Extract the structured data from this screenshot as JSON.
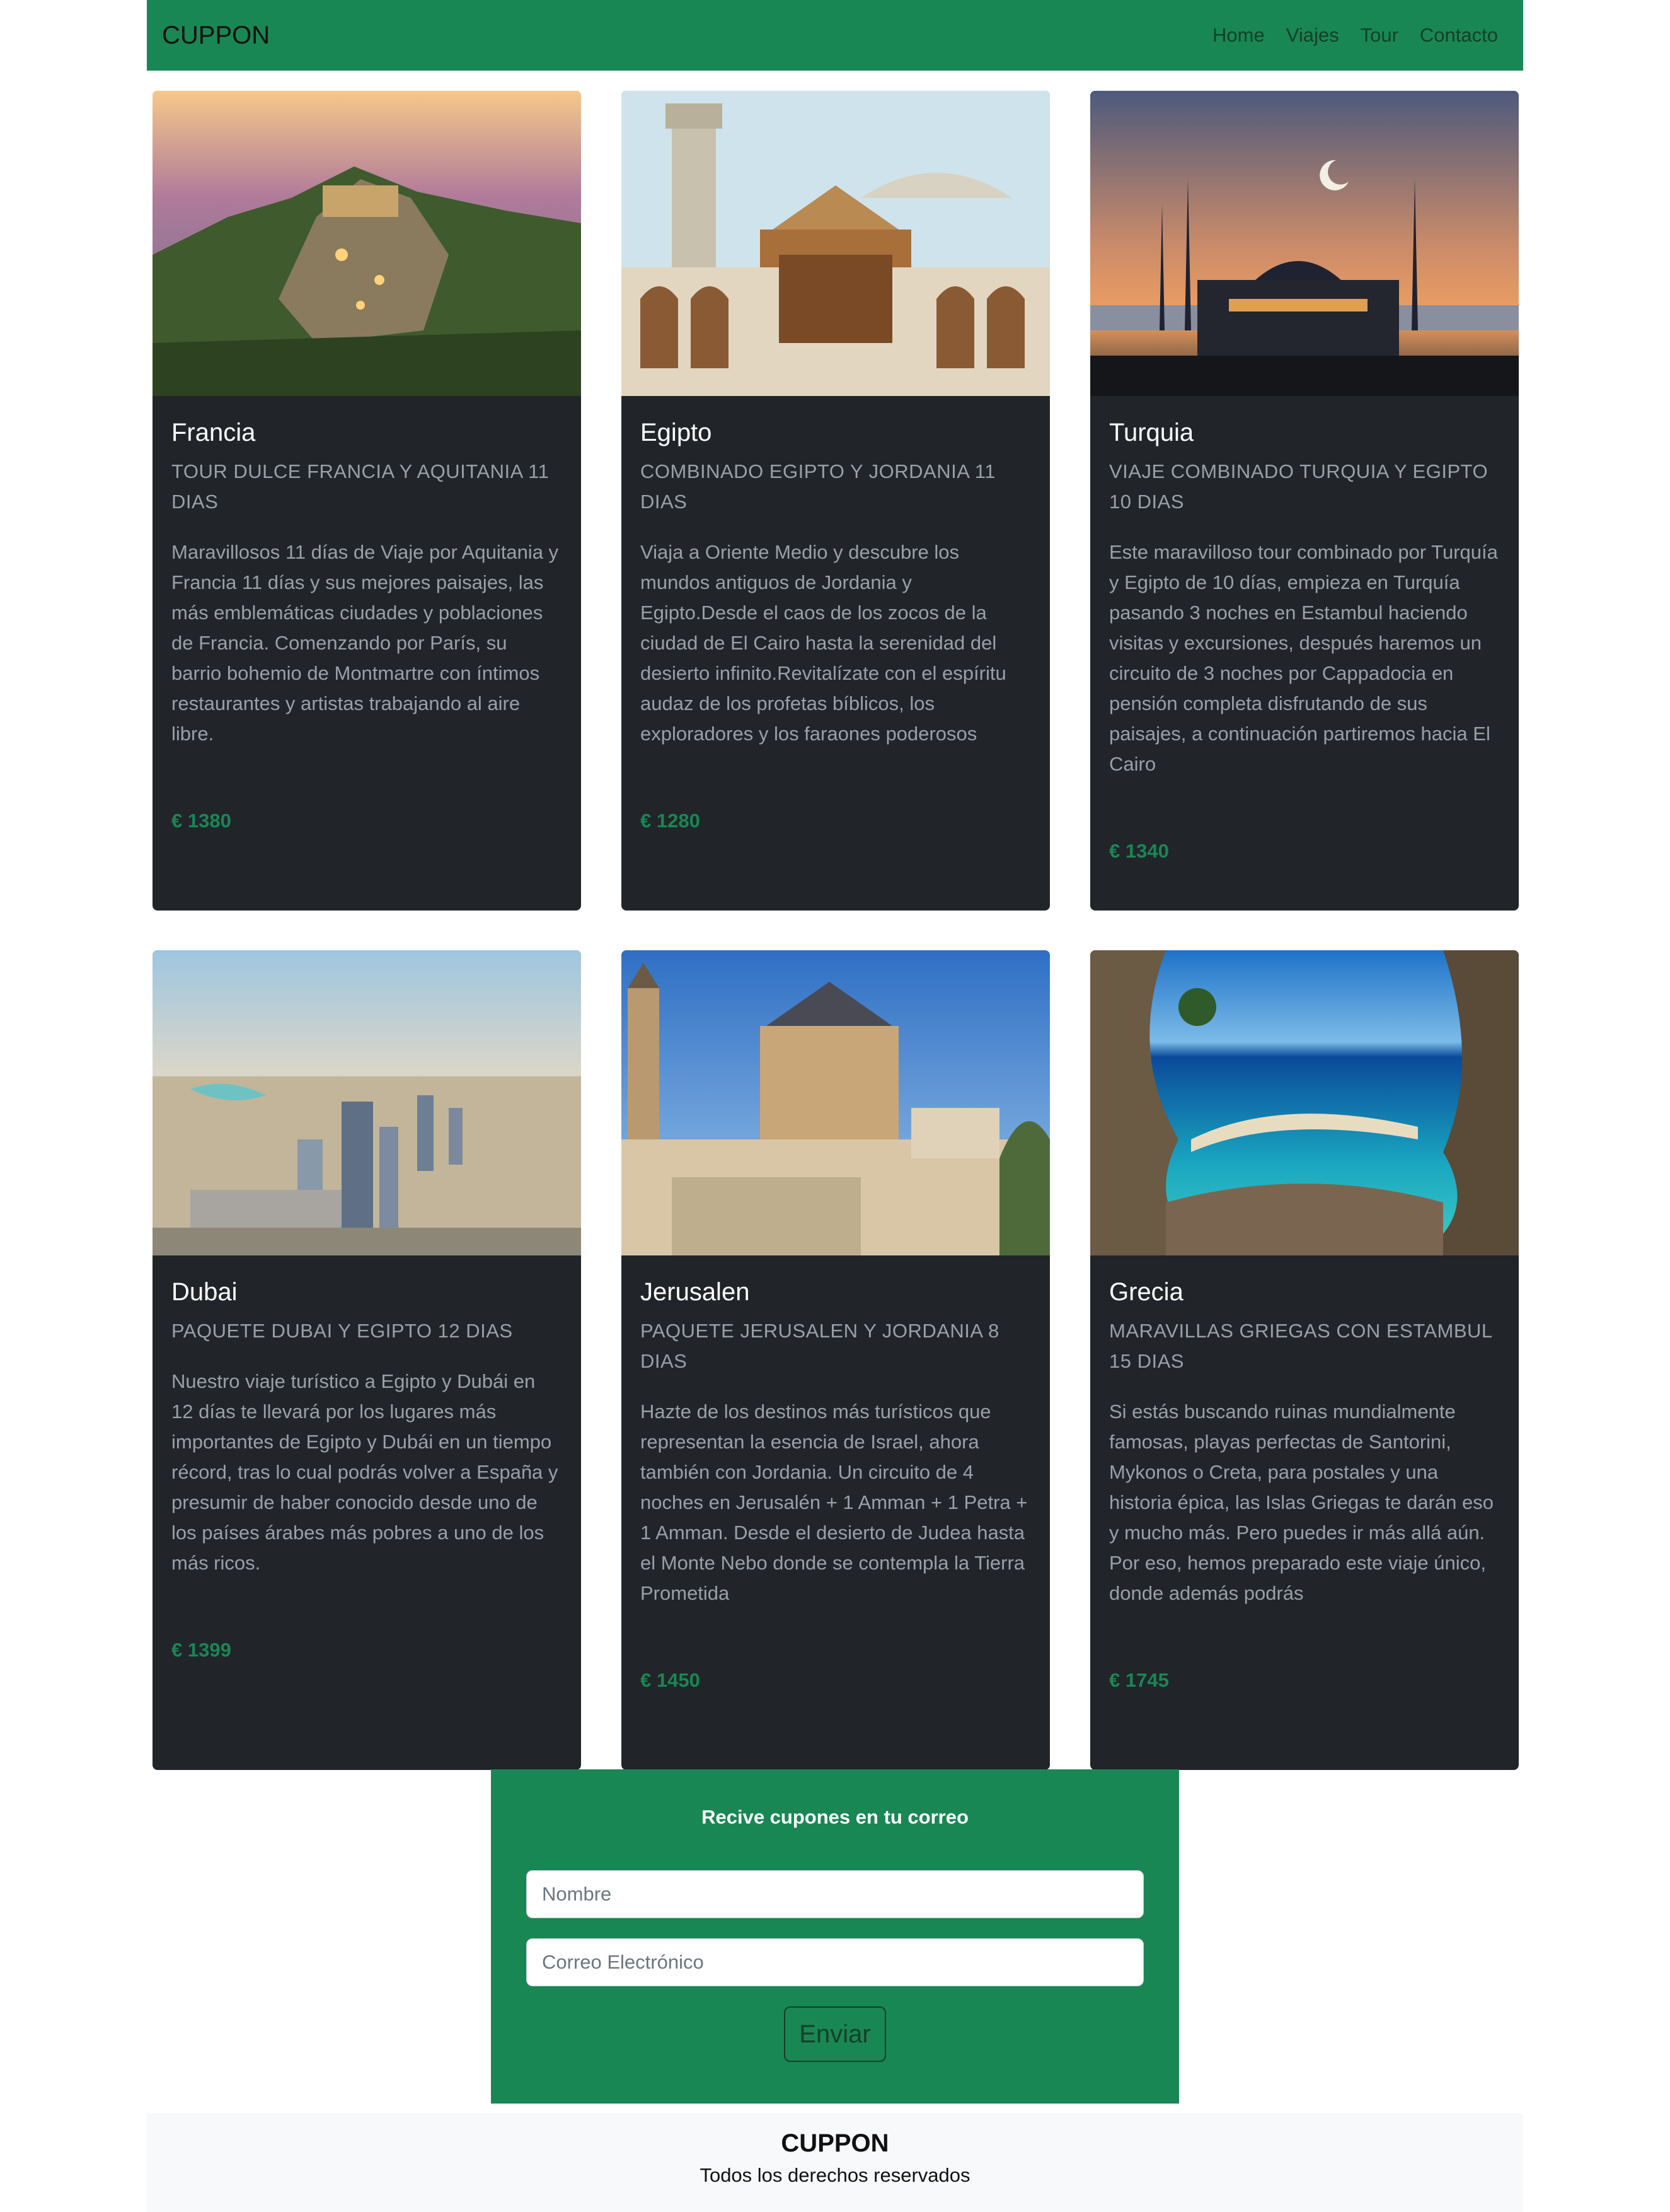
{
  "navbar": {
    "brand": "CUPPON",
    "links": [
      "Home",
      "Viajes",
      "Tour",
      "Contacto"
    ]
  },
  "cards": [
    {
      "title": "Francia",
      "subtitle": "TOUR DULCE FRANCIA Y AQUITANIA 11 DIAS",
      "text": "Maravillosos 11 días de Viaje por Aquitania y Francia 11 días y sus mejores paisajes, las más emblemáticas ciudades y poblaciones de Francia. Comenzando por París, su barrio bohemio de Montmartre con íntimos restaurantes y artistas trabajando al aire libre.",
      "price": "€ 1380"
    },
    {
      "title": "Egipto",
      "subtitle": "COMBINADO EGIPTO Y JORDANIA 11 DIAS",
      "text": "Viaja a Oriente Medio y descubre los mundos antiguos de Jordania y Egipto.Desde el caos de los zocos de la ciudad de El Cairo hasta la serenidad del desierto infinito.Revitalízate con el espíritu audaz de los profetas bíblicos, los exploradores y los faraones poderosos",
      "price": "€ 1280"
    },
    {
      "title": "Turquia",
      "subtitle": "VIAJE COMBINADO TURQUIA Y EGIPTO 10 DIAS",
      "text": "Este maravilloso tour combinado por Turquía y Egipto de 10 días, empieza en Turquía pasando 3 noches en Estambul haciendo visitas y excursiones, después haremos un circuito de 3 noches por Cappadocia en pensión completa disfrutando de sus paisajes, a continuación partiremos hacia El Cairo",
      "price": "€ 1340"
    },
    {
      "title": "Dubai",
      "subtitle": "PAQUETE DUBAI Y EGIPTO 12 DIAS",
      "text": "Nuestro viaje turístico a Egipto y Dubái en 12 días te llevará por los lugares más importantes de Egipto y Dubái en un tiempo récord, tras lo cual podrás volver a España y presumir de haber conocido desde uno de los países árabes más pobres a uno de los más ricos.",
      "price": "€ 1399"
    },
    {
      "title": "Jerusalen",
      "subtitle": "PAQUETE JERUSALEN Y JORDANIA 8 DIAS",
      "text": "Hazte de los destinos más turísticos que representan la esencia de Israel, ahora también con Jordania. Un circuito de 4 noches en Jerusalén + 1 Amman + 1 Petra + 1 Amman. Desde el desierto de Judea hasta el Monte Nebo donde se contempla la Tierra Prometida",
      "price": "€ 1450"
    },
    {
      "title": "Grecia",
      "subtitle": "MARAVILLAS GRIEGAS CON ESTAMBUL 15 DIAS",
      "text": "Si estás buscando ruinas mundialmente famosas, playas perfectas de Santorini, Mykonos o Creta, para postales y una historia épica, las Islas Griegas te darán eso y mucho más. Pero puedes ir más allá aún. Por eso, hemos preparado este viaje único, donde además podrás",
      "price": "€ 1745"
    }
  ],
  "coupon": {
    "title": "Recive cupones en tu correo",
    "name_placeholder": "Nombre",
    "email_placeholder": "Correo Electrónico",
    "submit_label": "Enviar"
  },
  "footer": {
    "brand": "CUPPON",
    "text": "Todos los derechos reservados"
  },
  "colors": {
    "accent": "#198754",
    "card_bg": "#212529",
    "footer_bg": "#f8f9fa"
  }
}
